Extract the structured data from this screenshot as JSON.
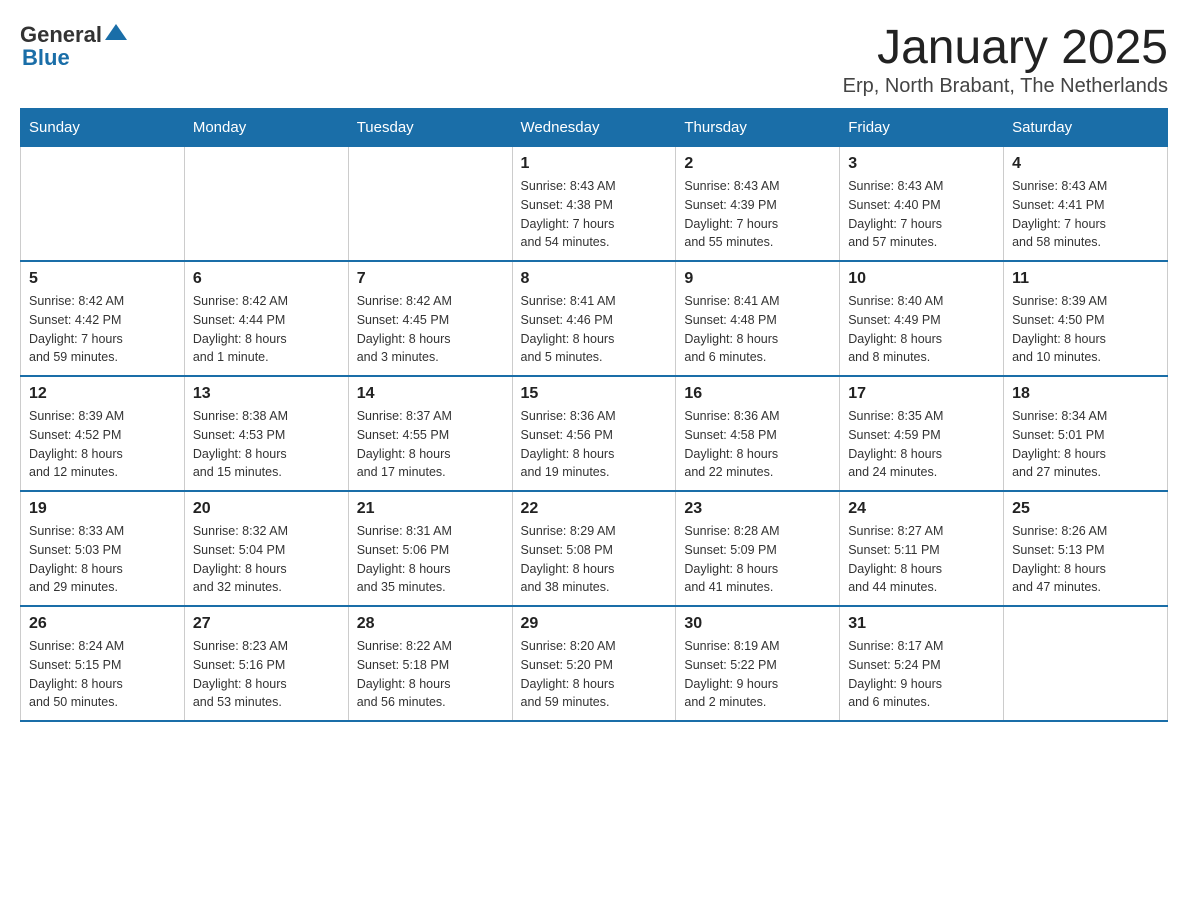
{
  "logo": {
    "text_general": "General",
    "text_blue": "Blue"
  },
  "title": "January 2025",
  "subtitle": "Erp, North Brabant, The Netherlands",
  "headers": [
    "Sunday",
    "Monday",
    "Tuesday",
    "Wednesday",
    "Thursday",
    "Friday",
    "Saturday"
  ],
  "weeks": [
    [
      {
        "day": "",
        "info": ""
      },
      {
        "day": "",
        "info": ""
      },
      {
        "day": "",
        "info": ""
      },
      {
        "day": "1",
        "info": "Sunrise: 8:43 AM\nSunset: 4:38 PM\nDaylight: 7 hours\nand 54 minutes."
      },
      {
        "day": "2",
        "info": "Sunrise: 8:43 AM\nSunset: 4:39 PM\nDaylight: 7 hours\nand 55 minutes."
      },
      {
        "day": "3",
        "info": "Sunrise: 8:43 AM\nSunset: 4:40 PM\nDaylight: 7 hours\nand 57 minutes."
      },
      {
        "day": "4",
        "info": "Sunrise: 8:43 AM\nSunset: 4:41 PM\nDaylight: 7 hours\nand 58 minutes."
      }
    ],
    [
      {
        "day": "5",
        "info": "Sunrise: 8:42 AM\nSunset: 4:42 PM\nDaylight: 7 hours\nand 59 minutes."
      },
      {
        "day": "6",
        "info": "Sunrise: 8:42 AM\nSunset: 4:44 PM\nDaylight: 8 hours\nand 1 minute."
      },
      {
        "day": "7",
        "info": "Sunrise: 8:42 AM\nSunset: 4:45 PM\nDaylight: 8 hours\nand 3 minutes."
      },
      {
        "day": "8",
        "info": "Sunrise: 8:41 AM\nSunset: 4:46 PM\nDaylight: 8 hours\nand 5 minutes."
      },
      {
        "day": "9",
        "info": "Sunrise: 8:41 AM\nSunset: 4:48 PM\nDaylight: 8 hours\nand 6 minutes."
      },
      {
        "day": "10",
        "info": "Sunrise: 8:40 AM\nSunset: 4:49 PM\nDaylight: 8 hours\nand 8 minutes."
      },
      {
        "day": "11",
        "info": "Sunrise: 8:39 AM\nSunset: 4:50 PM\nDaylight: 8 hours\nand 10 minutes."
      }
    ],
    [
      {
        "day": "12",
        "info": "Sunrise: 8:39 AM\nSunset: 4:52 PM\nDaylight: 8 hours\nand 12 minutes."
      },
      {
        "day": "13",
        "info": "Sunrise: 8:38 AM\nSunset: 4:53 PM\nDaylight: 8 hours\nand 15 minutes."
      },
      {
        "day": "14",
        "info": "Sunrise: 8:37 AM\nSunset: 4:55 PM\nDaylight: 8 hours\nand 17 minutes."
      },
      {
        "day": "15",
        "info": "Sunrise: 8:36 AM\nSunset: 4:56 PM\nDaylight: 8 hours\nand 19 minutes."
      },
      {
        "day": "16",
        "info": "Sunrise: 8:36 AM\nSunset: 4:58 PM\nDaylight: 8 hours\nand 22 minutes."
      },
      {
        "day": "17",
        "info": "Sunrise: 8:35 AM\nSunset: 4:59 PM\nDaylight: 8 hours\nand 24 minutes."
      },
      {
        "day": "18",
        "info": "Sunrise: 8:34 AM\nSunset: 5:01 PM\nDaylight: 8 hours\nand 27 minutes."
      }
    ],
    [
      {
        "day": "19",
        "info": "Sunrise: 8:33 AM\nSunset: 5:03 PM\nDaylight: 8 hours\nand 29 minutes."
      },
      {
        "day": "20",
        "info": "Sunrise: 8:32 AM\nSunset: 5:04 PM\nDaylight: 8 hours\nand 32 minutes."
      },
      {
        "day": "21",
        "info": "Sunrise: 8:31 AM\nSunset: 5:06 PM\nDaylight: 8 hours\nand 35 minutes."
      },
      {
        "day": "22",
        "info": "Sunrise: 8:29 AM\nSunset: 5:08 PM\nDaylight: 8 hours\nand 38 minutes."
      },
      {
        "day": "23",
        "info": "Sunrise: 8:28 AM\nSunset: 5:09 PM\nDaylight: 8 hours\nand 41 minutes."
      },
      {
        "day": "24",
        "info": "Sunrise: 8:27 AM\nSunset: 5:11 PM\nDaylight: 8 hours\nand 44 minutes."
      },
      {
        "day": "25",
        "info": "Sunrise: 8:26 AM\nSunset: 5:13 PM\nDaylight: 8 hours\nand 47 minutes."
      }
    ],
    [
      {
        "day": "26",
        "info": "Sunrise: 8:24 AM\nSunset: 5:15 PM\nDaylight: 8 hours\nand 50 minutes."
      },
      {
        "day": "27",
        "info": "Sunrise: 8:23 AM\nSunset: 5:16 PM\nDaylight: 8 hours\nand 53 minutes."
      },
      {
        "day": "28",
        "info": "Sunrise: 8:22 AM\nSunset: 5:18 PM\nDaylight: 8 hours\nand 56 minutes."
      },
      {
        "day": "29",
        "info": "Sunrise: 8:20 AM\nSunset: 5:20 PM\nDaylight: 8 hours\nand 59 minutes."
      },
      {
        "day": "30",
        "info": "Sunrise: 8:19 AM\nSunset: 5:22 PM\nDaylight: 9 hours\nand 2 minutes."
      },
      {
        "day": "31",
        "info": "Sunrise: 8:17 AM\nSunset: 5:24 PM\nDaylight: 9 hours\nand 6 minutes."
      },
      {
        "day": "",
        "info": ""
      }
    ]
  ]
}
